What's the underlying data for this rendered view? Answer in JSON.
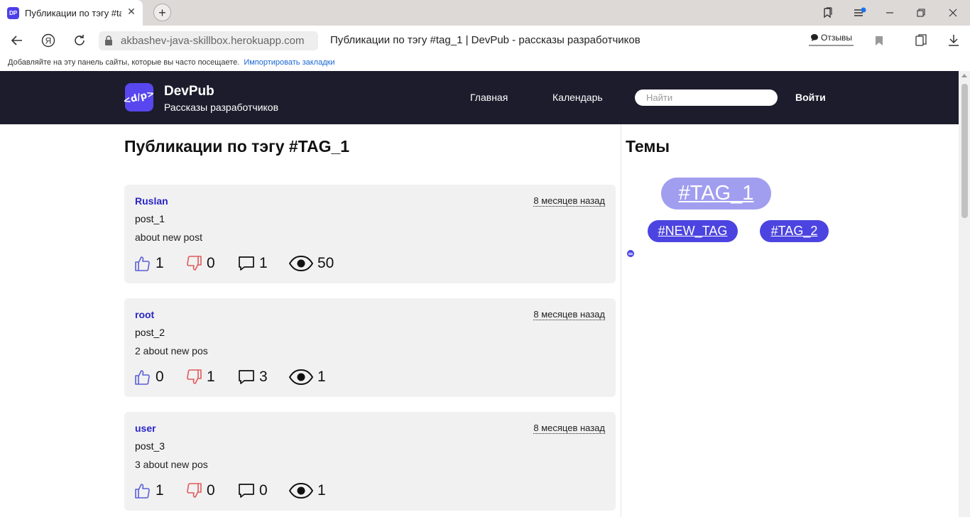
{
  "browser": {
    "tab_favicon": "DP",
    "tab_title": "Публикации по тэгу #tag_1",
    "url_domain": "akbashev-java-skillbox.herokuapp.com",
    "page_title": "Публикации по тэгу #tag_1 | DevPub - рассказы разработчиков",
    "reviews_label": "Отзывы",
    "bookmarks_hint": "Добавляйте на эту панель сайты, которые вы часто посещаете.",
    "bookmarks_import": "Импортировать закладки"
  },
  "site": {
    "logo_text": "<d/p>",
    "brand": "DevPub",
    "tagline": "Рассказы разработчиков",
    "nav": [
      "Главная",
      "Календарь"
    ],
    "search_placeholder": "Найти",
    "login": "Войти"
  },
  "main": {
    "heading": "Публикации по тэгу #TAG_1",
    "posts": [
      {
        "author": "Ruslan",
        "time": "8 месяцев назад",
        "title": "post_1",
        "text": "about new post",
        "likes": "1",
        "dislikes": "0",
        "comments": "1",
        "views": "50"
      },
      {
        "author": "root",
        "time": "8 месяцев назад",
        "title": "post_2",
        "text": "2 about new pos",
        "likes": "0",
        "dislikes": "1",
        "comments": "3",
        "views": "1"
      },
      {
        "author": "user",
        "time": "8 месяцев назад",
        "title": "post_3",
        "text": "3 about new pos",
        "likes": "1",
        "dislikes": "0",
        "comments": "0",
        "views": "1"
      }
    ]
  },
  "sidebar": {
    "heading": "Темы",
    "tags": [
      "#TAG_1",
      "#NEW_TAG",
      "#TAG_2"
    ]
  },
  "colors": {
    "header_bg": "#1c1c2c",
    "accent": "#4c44e0",
    "author_link": "#2a25c8",
    "like": "#5a5fd6",
    "dislike": "#e05a5a"
  },
  "icons": [
    "lock-icon",
    "back-icon",
    "yandex-icon",
    "reload-icon",
    "bookmark-icon",
    "like-icon",
    "dislike-icon",
    "comment-icon",
    "eye-icon",
    "download-icon"
  ]
}
